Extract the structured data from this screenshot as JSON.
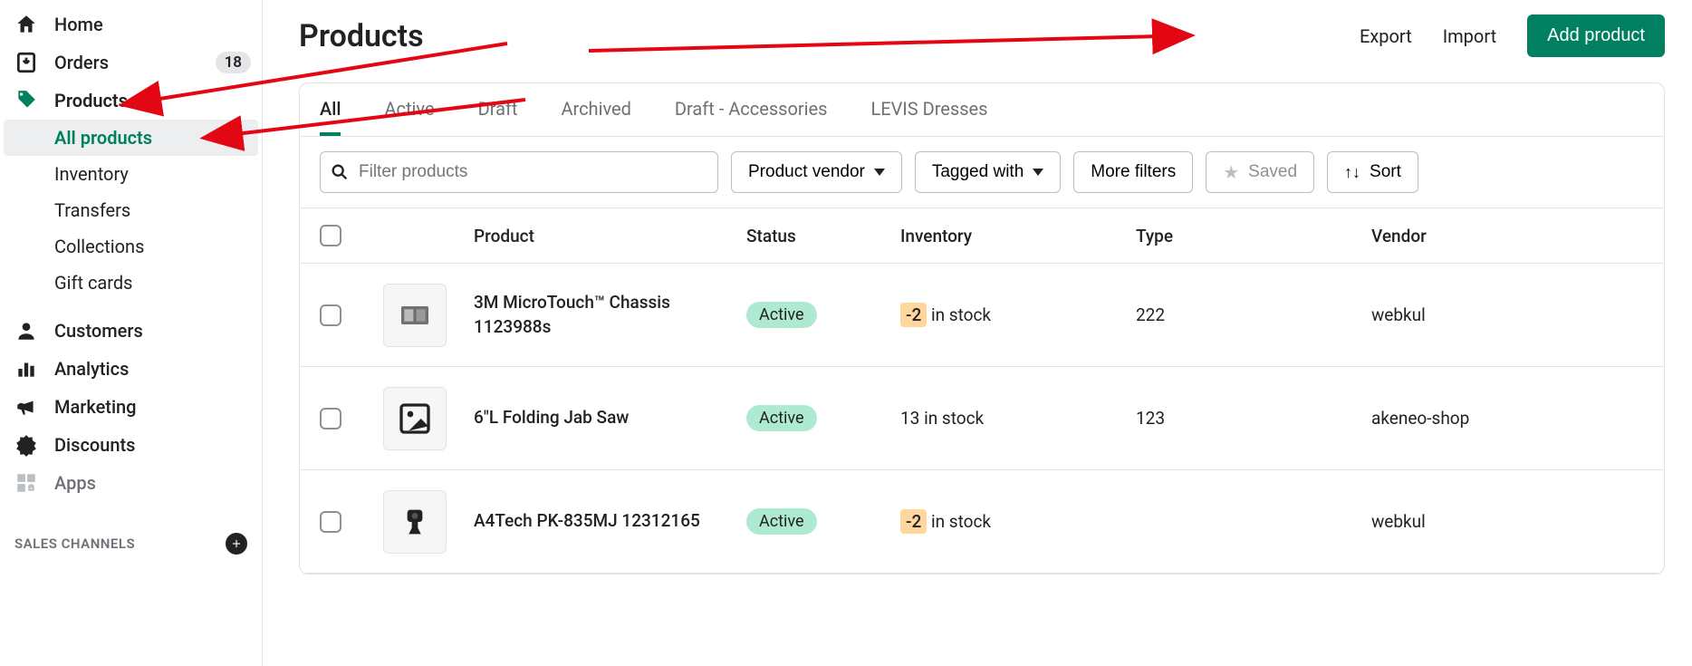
{
  "sidebar": {
    "home": "Home",
    "orders": "Orders",
    "orders_badge": "18",
    "products": "Products",
    "sub": {
      "all_products": "All products",
      "inventory": "Inventory",
      "transfers": "Transfers",
      "collections": "Collections",
      "gift_cards": "Gift cards"
    },
    "customers": "Customers",
    "analytics": "Analytics",
    "marketing": "Marketing",
    "discounts": "Discounts",
    "apps": "Apps",
    "sales_channels": "SALES CHANNELS"
  },
  "header": {
    "title": "Products",
    "export": "Export",
    "import": "Import",
    "add_product": "Add product"
  },
  "tabs": {
    "all": "All",
    "active": "Active",
    "draft": "Draft",
    "archived": "Archived",
    "draft_acc": "Draft - Accessories",
    "levis": "LEVIS Dresses"
  },
  "filters": {
    "placeholder": "Filter products",
    "vendor": "Product vendor",
    "tagged": "Tagged with",
    "more": "More filters",
    "saved": "Saved",
    "sort": "Sort"
  },
  "columns": {
    "product": "Product",
    "status": "Status",
    "inventory": "Inventory",
    "type": "Type",
    "vendor": "Vendor"
  },
  "rows": [
    {
      "name": "3M MicroTouch™ Chassis 1123988s",
      "status": "Active",
      "inventory_qty": "-2",
      "inventory_suffix": " in stock",
      "inventory_warn": true,
      "type": "222",
      "vendor": "webkul",
      "thumb": "device"
    },
    {
      "name": "6\"L Folding Jab Saw",
      "status": "Active",
      "inventory_qty": "13",
      "inventory_suffix": " in stock",
      "inventory_warn": false,
      "type": "123",
      "vendor": "akeneo-shop",
      "thumb": "placeholder"
    },
    {
      "name": "A4Tech PK-835MJ 12312165",
      "status": "Active",
      "inventory_qty": "-2",
      "inventory_suffix": " in stock",
      "inventory_warn": true,
      "type": "",
      "vendor": "webkul",
      "thumb": "camera"
    }
  ]
}
